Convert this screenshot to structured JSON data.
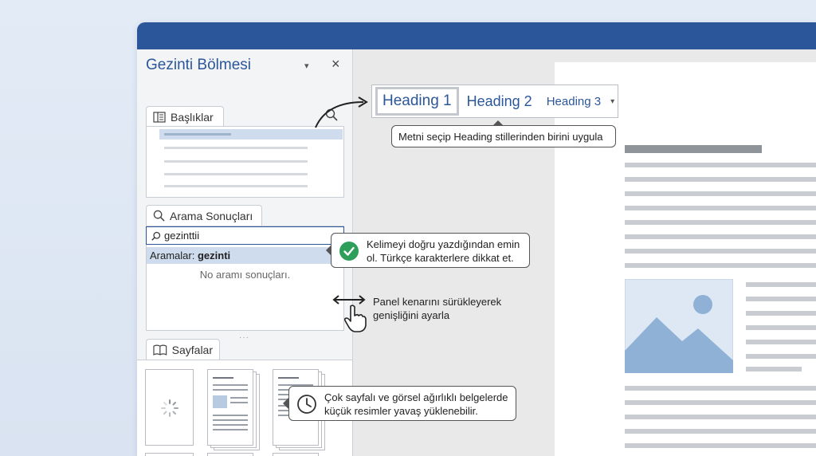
{
  "nav_pane": {
    "title": "Gezinti Bölmesi",
    "menu_glyph": "▾",
    "close_glyph": "×",
    "tabs": {
      "headings": "Başlıklar",
      "search_results": "Arama Sonuçları",
      "pages": "Sayfalar"
    },
    "search": {
      "value": "gezinttii",
      "clear_glyph": "×",
      "results_prefix": "Aramalar:",
      "results_term": "gezinti",
      "no_results": "No aramı sonuçları."
    }
  },
  "ribbon": {
    "styles": [
      "Heading 1",
      "Heading 2",
      "Heading 3"
    ],
    "more_glyph": "▾"
  },
  "callouts": {
    "heading_tip": "Metni seçip Heading stillerinden birini uygula",
    "spelling_tip_line1": "Kelimeyi doğru yazdığından emin",
    "spelling_tip_line2": "ol. Türkçe karakterlere dikkat et.",
    "resize_tip_line1": "Panel kenarını sürükleyerek",
    "resize_tip_line2": "genişliğini ayarla",
    "thumbs_tip_line1": "Çok sayfalı ve görsel ağırlıklı belgelerde",
    "thumbs_tip_line2": "küçük resimler yavaş yüklenebilir."
  },
  "colors": {
    "accent": "#2b579a",
    "check_green": "#2e9e5b",
    "image_blue": "#9bbad9"
  },
  "icons": [
    "heading-list-icon",
    "search-icon",
    "magnifier-icon",
    "book-icon",
    "check-icon",
    "resize-arrow-icon",
    "hand-cursor-icon",
    "clock-icon",
    "spinner-icon",
    "image-placeholder-icon"
  ]
}
